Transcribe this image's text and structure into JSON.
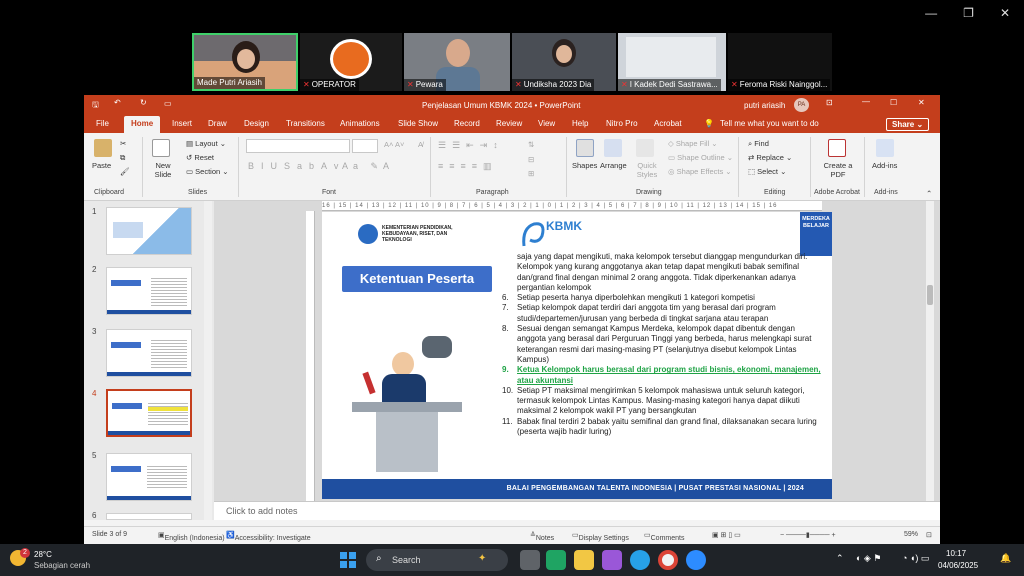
{
  "zoom": {
    "participants": [
      {
        "name": "Made Putri Ariasih",
        "muted": false
      },
      {
        "name": "OPERATOR",
        "muted": true
      },
      {
        "name": "Pewara",
        "muted": true
      },
      {
        "name": "Undiksha 2023 Dia",
        "muted": true
      },
      {
        "name": "I Kadek Dedi Sastrawa...",
        "muted": true
      },
      {
        "name": "Feroma Riski Nainggol...",
        "muted": true
      }
    ]
  },
  "window": {
    "title": "Penjelasan Umum KBMK 2024 • PowerPoint",
    "user": "putri ariasih",
    "user_initials": "PA"
  },
  "tabs": [
    "File",
    "Home",
    "Insert",
    "Draw",
    "Design",
    "Transitions",
    "Animations",
    "Slide Show",
    "Record",
    "Review",
    "View",
    "Help",
    "Nitro Pro",
    "Acrobat"
  ],
  "active_tab": "Home",
  "tell_me": "Tell me what you want to do",
  "share_label": "Share",
  "ribbon": {
    "clipboard": {
      "paste": "Paste",
      "label": "Clipboard"
    },
    "slides": {
      "new_slide": "New Slide",
      "layout": "Layout",
      "reset": "Reset",
      "section": "Section",
      "label": "Slides"
    },
    "font": {
      "label": "Font"
    },
    "paragraph": {
      "label": "Paragraph"
    },
    "drawing": {
      "shapes": "Shapes",
      "arrange": "Arrange",
      "quick_styles": "Quick Styles",
      "shape_fill": "Shape Fill",
      "shape_outline": "Shape Outline",
      "shape_effects": "Shape Effects",
      "label": "Drawing"
    },
    "editing": {
      "find": "Find",
      "replace": "Replace",
      "select": "Select",
      "label": "Editing"
    },
    "acrobat": {
      "create_pdf": "Create a PDF",
      "label": "Adobe Acrobat"
    },
    "addins": {
      "addins": "Add-ins",
      "label": "Add-ins"
    }
  },
  "thumbnails": [
    {
      "num": "1"
    },
    {
      "num": "2"
    },
    {
      "num": "3"
    },
    {
      "num": "4"
    },
    {
      "num": "5"
    },
    {
      "num": "6"
    }
  ],
  "selected_slide": "4",
  "ruler_text": "16 | 15 | 14 | 13 | 12 | 11 | 10 | 9 | 8 | 7 | 6 | 5 | 4 | 3 | 2 | 1 | 0 | 1 | 2 | 3 | 4 | 5 | 6 | 7 | 8 | 9 | 10 | 11 | 12 | 13 | 14 | 15 | 16",
  "slide": {
    "ministry": "KEMENTERIAN PENDIDIKAN, KEBUDAYAAN, RISET, DAN TEKNOLOGI",
    "kbmk_logo": "KBMK",
    "badge": "MERDEKA BELAJAR",
    "heading": "Ketentuan Peserta",
    "items": [
      {
        "n": "",
        "text": "saja yang dapat mengikuti, maka kelompok tersebut dianggap mengundurkan diri. Kelompok yang kurang anggotanya akan tetap dapat mengikuti babak semifinal dan/grand final dengan minimal 2 orang anggota. Tidak diperkenankan adanya pergantian kelompok",
        "highlight": false
      },
      {
        "n": "6.",
        "text": "Setiap peserta hanya diperbolehkan mengikuti 1 kategori kompetisi",
        "highlight": false
      },
      {
        "n": "7.",
        "text": "Setiap kelompok dapat terdiri dari anggota tim yang berasal dari program studi/departemen/jurusan yang berbeda di tingkat sarjana atau terapan",
        "highlight": false
      },
      {
        "n": "8.",
        "text": "Sesuai dengan semangat Kampus Merdeka, kelompok dapat dibentuk dengan anggota yang berasal dari Perguruan Tinggi yang berbeda, harus melengkapi surat keterangan resmi dari masing-masing PT (selanjutnya disebut kelompok Lintas Kampus)",
        "highlight": false
      },
      {
        "n": "9.",
        "text": "Ketua Kelompok harus berasal dari program studi bisnis, ekonomi, manajemen, atau akuntansi",
        "highlight": true
      },
      {
        "n": "10.",
        "text": "Setiap PT maksimal mengirimkan 5 kelompok mahasiswa untuk seluruh kategori, termasuk kelompok Lintas Kampus. Masing-masing kategori hanya dapat diikuti maksimal 2 kelompok wakil PT yang bersangkutan",
        "highlight": false
      },
      {
        "n": "11.",
        "text": "Babak final terdiri 2 babak yaitu semifinal dan grand final, dilaksanakan secara luring (peserta wajib hadir luring)",
        "highlight": false
      }
    ],
    "footer": "BALAI PENGEMBANGAN TALENTA INDONESIA  |  PUSAT PRESTASI NASIONAL  |  2024"
  },
  "notes_placeholder": "Click to add notes",
  "status": {
    "slide_of": "Slide 3 of 9",
    "language": "English (Indonesia)",
    "accessibility": "Accessibility: Investigate",
    "notes": "Notes",
    "display": "Display Settings",
    "comments": "Comments",
    "zoom": "59%"
  },
  "taskbar": {
    "temp": "28°C",
    "weather": "Sebagian cerah",
    "search": "Search",
    "time": "10:17",
    "date": "04/06/2025",
    "notif_count": "2"
  }
}
